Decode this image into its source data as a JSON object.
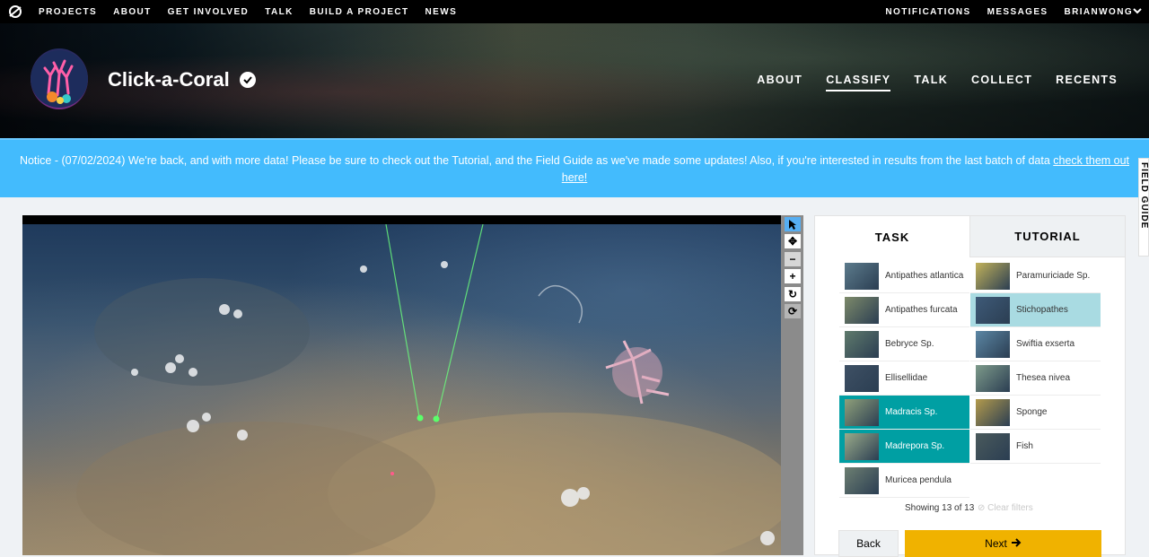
{
  "topnav": {
    "links": [
      "PROJECTS",
      "ABOUT",
      "GET INVOLVED",
      "TALK",
      "BUILD A PROJECT",
      "NEWS"
    ],
    "right": [
      "NOTIFICATIONS",
      "MESSAGES",
      "BRIANWONG"
    ]
  },
  "project": {
    "title": "Click-a-Coral",
    "nav": [
      "ABOUT",
      "CLASSIFY",
      "TALK",
      "COLLECT",
      "RECENTS"
    ],
    "active_nav": "CLASSIFY"
  },
  "notice": {
    "text": "Notice - (07/02/2024) We're back, and with more data! Please be sure to check out the Tutorial, and the Field Guide as we've made some updates! Also, if you're interested in results from the last batch of data ",
    "link": "check them out here!"
  },
  "field_guide": "FIELD GUIDE",
  "panel": {
    "tabs": [
      "TASK",
      "TUTORIAL"
    ],
    "active_tab": "TASK",
    "choices": [
      {
        "label": "Antipathes atlantica",
        "selected": "none",
        "thumb": "#5c7b8c"
      },
      {
        "label": "Paramuriciade Sp.",
        "selected": "none",
        "thumb": "#c2b25a"
      },
      {
        "label": "Antipathes furcata",
        "selected": "none",
        "thumb": "#7d8a6a"
      },
      {
        "label": "Stichopathes",
        "selected": "light",
        "thumb": "#3e5a78"
      },
      {
        "label": "Bebryce Sp.",
        "selected": "none",
        "thumb": "#5f7a6c"
      },
      {
        "label": "Swiftia exserta",
        "selected": "none",
        "thumb": "#5b86a4"
      },
      {
        "label": "Ellisellidae",
        "selected": "none",
        "thumb": "#3e5064"
      },
      {
        "label": "Thesea nivea",
        "selected": "none",
        "thumb": "#7d9a8a"
      },
      {
        "label": "Madracis Sp.",
        "selected": "dark",
        "thumb": "#8fa07a"
      },
      {
        "label": "Sponge",
        "selected": "none",
        "thumb": "#b39a4c"
      },
      {
        "label": "Madrepora Sp.",
        "selected": "dark",
        "thumb": "#9aab8a"
      },
      {
        "label": "Fish",
        "selected": "none",
        "thumb": "#4a5a5c"
      },
      {
        "label": "Muricea pendula",
        "selected": "none",
        "thumb": "#6d7f72"
      }
    ],
    "showing": "Showing 13 of 13",
    "clear_filters": "Clear filters"
  },
  "buttons": {
    "back": "Back",
    "next": "Next"
  },
  "colors": {
    "notice_bg": "#43bbfd",
    "selected_dark": "#009fa3",
    "selected_light": "#a9dbe2",
    "next_button": "#f0b200",
    "tool_active": "#56aef2"
  },
  "icons": {
    "toolbar": [
      "pointer-icon",
      "move-icon",
      "zoom-out-icon",
      "zoom-in-icon",
      "rotate-icon",
      "reset-icon"
    ]
  }
}
